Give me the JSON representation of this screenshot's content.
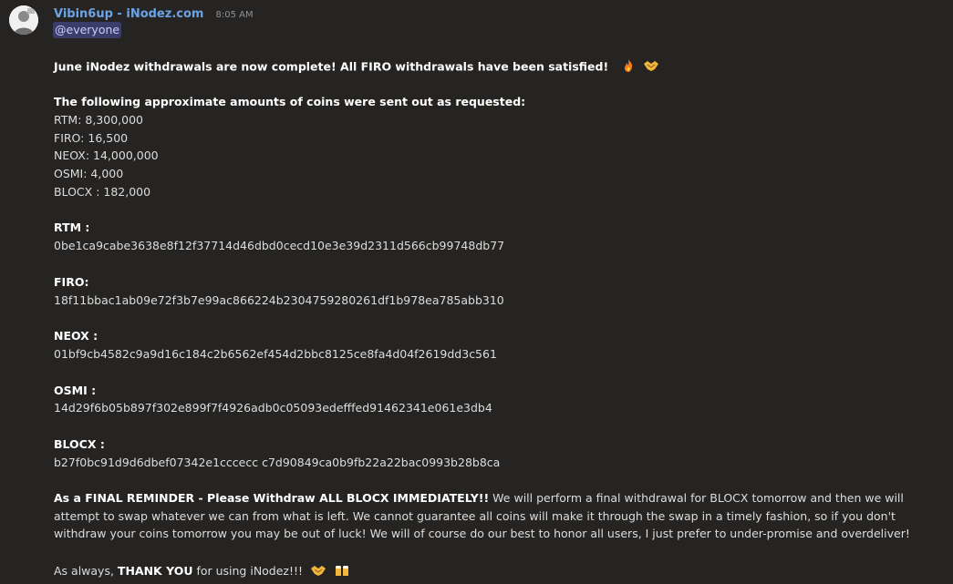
{
  "message": {
    "author": "Vibin6up - iNodez.com",
    "timestamp": "8:05 AM",
    "mention": "@everyone",
    "headline": "June iNodez withdrawals are now complete!  All FIRO withdrawals have been satisfied!",
    "headline_emojis": [
      "fire-icon",
      "handshake-icon"
    ],
    "amounts_heading": "The following approximate amounts of coins were sent out as requested:",
    "amounts": [
      "RTM: 8,300,000",
      "FIRO: 16,500",
      "NEOX: 14,000,000",
      "OSMI: 4,000",
      "BLOCX : 182,000"
    ],
    "transactions": [
      {
        "coin": "RTM :",
        "txid": "0be1ca9cabe3638e8f12f37714d46dbd0cecd10e3e39d2311d566cb99748db77"
      },
      {
        "coin": "FIRO:",
        "txid": "18f11bbac1ab09e72f3b7e99ac866224b2304759280261df1b978ea785abb310"
      },
      {
        "coin": "NEOX :",
        "txid": "01bf9cb4582c9a9d16c184c2b6562ef454d2bbc8125ce8fa4d04f2619dd3c561"
      },
      {
        "coin": "OSMI :",
        "txid": "14d29f6b05b897f302e899f7f4926adb0c05093edefffed91462341e061e3db4"
      },
      {
        "coin": "BLOCX :",
        "txid": "b27f0bc91d9d6dbef07342e1cccecc c7d90849ca0b9fb22a22bac0993b28b8ca"
      }
    ],
    "reminder_bold": "As a FINAL REMINDER - Please Withdraw ALL BLOCX IMMEDIATELY!!",
    "reminder_text": " We will perform a final withdrawal for BLOCX tomorrow and then we will attempt to swap whatever we can from what is left.  We cannot guarantee all coins will make it through the swap in a timely fashion, so if you don't withdraw your coins tomorrow you may be out of luck!  We will of course do our best to honor all users, I just prefer to under-promise and overdeliver!",
    "closing_pre": "As always, ",
    "closing_bold": "THANK YOU",
    "closing_post": " for using iNodez!!!",
    "closing_emojis": [
      "handshake-icon",
      "beer-icon"
    ]
  }
}
